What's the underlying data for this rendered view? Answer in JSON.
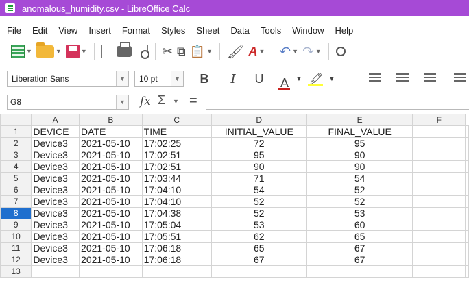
{
  "window": {
    "title": "anomalous_humidity.csv - LibreOffice Calc"
  },
  "menu": [
    "File",
    "Edit",
    "View",
    "Insert",
    "Format",
    "Styles",
    "Sheet",
    "Data",
    "Tools",
    "Window",
    "Help"
  ],
  "toolbar": {
    "icons": [
      "calc-new-icon",
      "open-folder-icon",
      "save-icon",
      "export-icon",
      "export-pdf-icon",
      "print-icon",
      "print-preview-icon",
      "cut-icon",
      "copy-icon",
      "paste-icon",
      "clone-format-icon",
      "clear-format-icon",
      "undo-icon",
      "redo-icon",
      "find-icon"
    ]
  },
  "format_bar": {
    "font_name": "Liberation Sans",
    "font_size": "10 pt",
    "bold": "B",
    "italic": "I",
    "underline": "U",
    "font_color_glyph": "A",
    "font_color": "#c9211e",
    "highlight_color": "#ffff38"
  },
  "formula_bar": {
    "cell_ref": "G8",
    "function_glyph": "fx",
    "sum_glyph": "Σ",
    "equals_glyph": "=",
    "formula": ""
  },
  "sheet": {
    "columns": [
      "A",
      "B",
      "C",
      "D",
      "E",
      "F"
    ],
    "active_row": "8",
    "rows": [
      {
        "num": "1",
        "cells": [
          "DEVICE",
          "DATE",
          "TIME",
          "INITIAL_VALUE",
          "FINAL_VALUE",
          ""
        ]
      },
      {
        "num": "2",
        "cells": [
          "Device3",
          "2021-05-10",
          "17:02:25",
          "72",
          "95",
          ""
        ]
      },
      {
        "num": "3",
        "cells": [
          "Device3",
          "2021-05-10",
          "17:02:51",
          "95",
          "90",
          ""
        ]
      },
      {
        "num": "4",
        "cells": [
          "Device3",
          "2021-05-10",
          "17:02:51",
          "90",
          "90",
          ""
        ]
      },
      {
        "num": "5",
        "cells": [
          "Device3",
          "2021-05-10",
          "17:03:44",
          "71",
          "54",
          ""
        ]
      },
      {
        "num": "6",
        "cells": [
          "Device3",
          "2021-05-10",
          "17:04:10",
          "54",
          "52",
          ""
        ]
      },
      {
        "num": "7",
        "cells": [
          "Device3",
          "2021-05-10",
          "17:04:10",
          "52",
          "52",
          ""
        ]
      },
      {
        "num": "8",
        "cells": [
          "Device3",
          "2021-05-10",
          "17:04:38",
          "52",
          "53",
          ""
        ]
      },
      {
        "num": "9",
        "cells": [
          "Device3",
          "2021-05-10",
          "17:05:04",
          "53",
          "60",
          ""
        ]
      },
      {
        "num": "10",
        "cells": [
          "Device3",
          "2021-05-10",
          "17:05:51",
          "62",
          "65",
          ""
        ]
      },
      {
        "num": "11",
        "cells": [
          "Device3",
          "2021-05-10",
          "17:06:18",
          "65",
          "67",
          ""
        ]
      },
      {
        "num": "12",
        "cells": [
          "Device3",
          "2021-05-10",
          "17:06:18",
          "67",
          "67",
          ""
        ]
      },
      {
        "num": "13",
        "cells": [
          "",
          "",
          "",
          "",
          "",
          ""
        ]
      }
    ]
  }
}
